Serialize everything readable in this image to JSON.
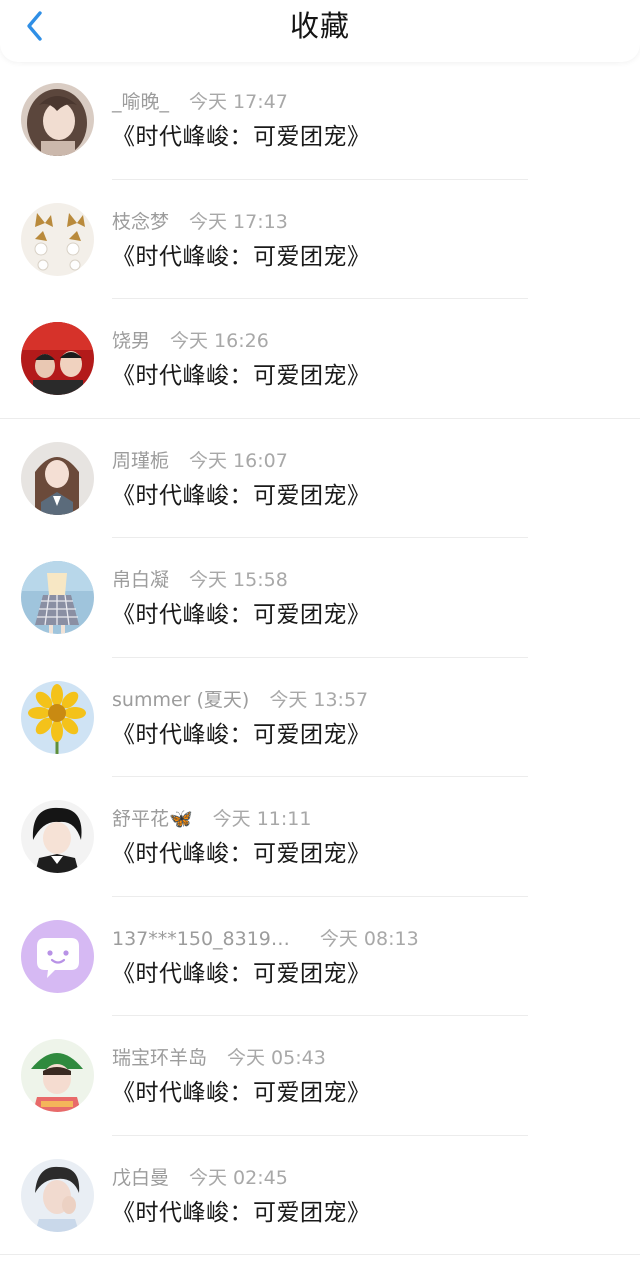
{
  "header": {
    "title": "收藏"
  },
  "colors": {
    "accent": "#2f8fe6"
  },
  "items": [
    {
      "name": "_喻晚_",
      "time": "今天 17:47",
      "message": "《时代峰峻：可爱团宠》",
      "avatar": "girl-photo"
    },
    {
      "name": "枝念梦",
      "time": "今天 17:13",
      "message": "《时代峰峻：可爱团宠》",
      "avatar": "pearl-earrings-photo"
    },
    {
      "name": "饶男",
      "time": "今天 16:26",
      "message": "《时代峰峻：可爱团宠》",
      "avatar": "group-red-photo"
    },
    {
      "name": "周瑾栀",
      "time": "今天 16:07",
      "message": "《时代峰峻：可爱团宠》",
      "avatar": "girl-uniform-photo"
    },
    {
      "name": "帛白凝",
      "time": "今天 15:58",
      "message": "《时代峰峻：可爱团宠》",
      "avatar": "plaid-skirt-photo"
    },
    {
      "name": "summer (夏天)",
      "time": "今天 13:57",
      "message": "《时代峰峻：可爱团宠》",
      "avatar": "sunflower-photo"
    },
    {
      "name": "舒平花🦋",
      "time": "今天 11:11",
      "message": "《时代峰峻：可爱团宠》",
      "avatar": "boy-black-hair-photo"
    },
    {
      "name": "137***150_8319…",
      "time": "今天 08:13",
      "message": "《时代峰峻：可爱团宠》",
      "avatar": "default-chat-avatar"
    },
    {
      "name": "瑞宝环羊岛",
      "time": "今天 05:43",
      "message": "《时代峰峻：可爱团宠》",
      "avatar": "boy-green-hat-photo"
    },
    {
      "name": "戊白曼",
      "time": "今天 02:45",
      "message": "《时代峰峻：可爱团宠》",
      "avatar": "boy-hand-face-photo"
    }
  ]
}
